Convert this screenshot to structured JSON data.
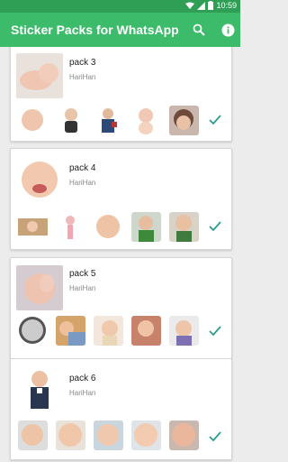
{
  "status": {
    "time": "10:59"
  },
  "appbar": {
    "title": "Sticker Packs for WhatsApp"
  },
  "packs": [
    {
      "name": "pack 3",
      "author": "HariHan"
    },
    {
      "name": "pack 4",
      "author": "HariHan"
    },
    {
      "name": "pack 5",
      "author": "HariHan"
    },
    {
      "name": "pack 6",
      "author": "HariHan"
    }
  ],
  "colors": {
    "statusbar": "#2e9f55",
    "appbar": "#3cbb6a",
    "check": "#2a9d8f"
  },
  "icons": [
    "wifi-icon",
    "signal-icon",
    "battery-icon",
    "search-icon",
    "info-icon",
    "check-icon"
  ]
}
